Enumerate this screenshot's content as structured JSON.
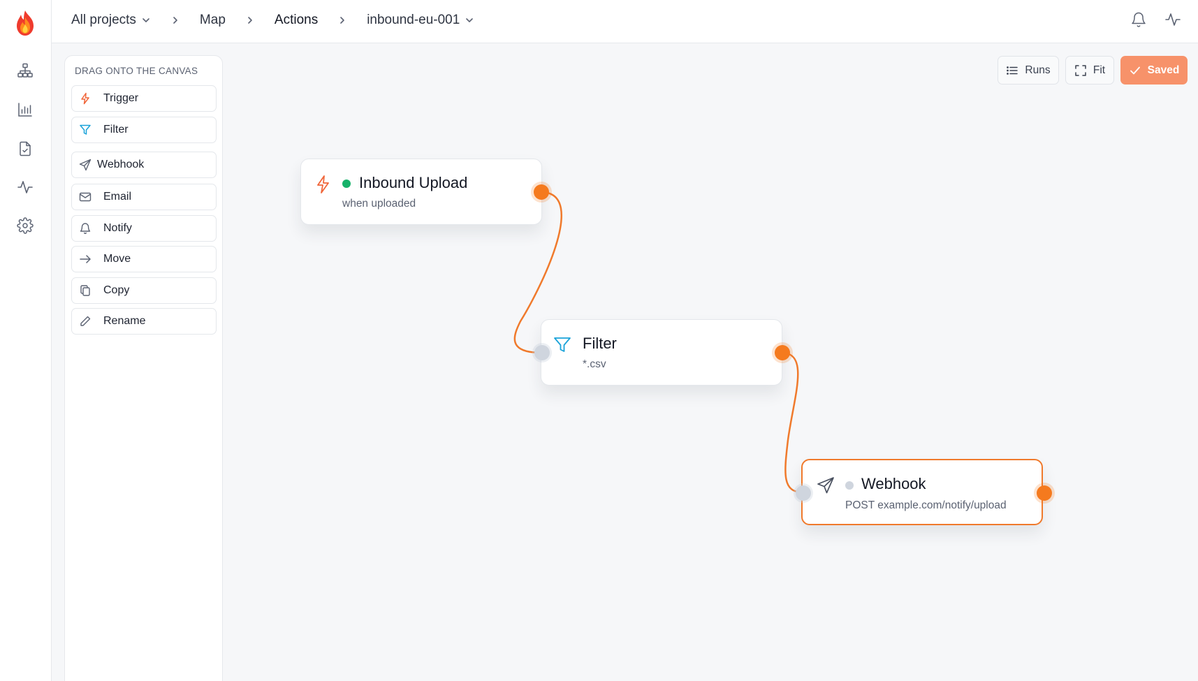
{
  "breadcrumb": {
    "projects": "All projects",
    "map": "Map",
    "actions": "Actions",
    "resource": "inbound-eu-001"
  },
  "palette": {
    "title": "Drag onto the canvas",
    "items": [
      {
        "label": "Trigger",
        "icon": "bolt-icon"
      },
      {
        "label": "Filter",
        "icon": "funnel-icon"
      },
      {
        "label": "Webhook",
        "icon": "send-icon"
      },
      {
        "label": "Email",
        "icon": "mail-icon"
      },
      {
        "label": "Notify",
        "icon": "bell-icon"
      },
      {
        "label": "Move",
        "icon": "arrow-right-icon"
      },
      {
        "label": "Copy",
        "icon": "copy-icon"
      },
      {
        "label": "Rename",
        "icon": "pencil-icon"
      }
    ]
  },
  "toolbar": {
    "runs_label": "Runs",
    "fit_label": "Fit",
    "saved_label": "Saved"
  },
  "nodes": [
    {
      "title": "Inbound Upload",
      "subtitle": "when uploaded",
      "status": "active"
    },
    {
      "title": "Filter",
      "subtitle": "*.csv"
    },
    {
      "title": "Webhook",
      "subtitle": "POST example.com/notify/upload",
      "status": "idle",
      "selected": true
    }
  ],
  "colors": {
    "accent": "#f57a1e",
    "saved_button": "#f7926a",
    "status_active": "#17b26a",
    "status_idle": "#cfd5de",
    "filter_icon": "#1aa3d9"
  }
}
